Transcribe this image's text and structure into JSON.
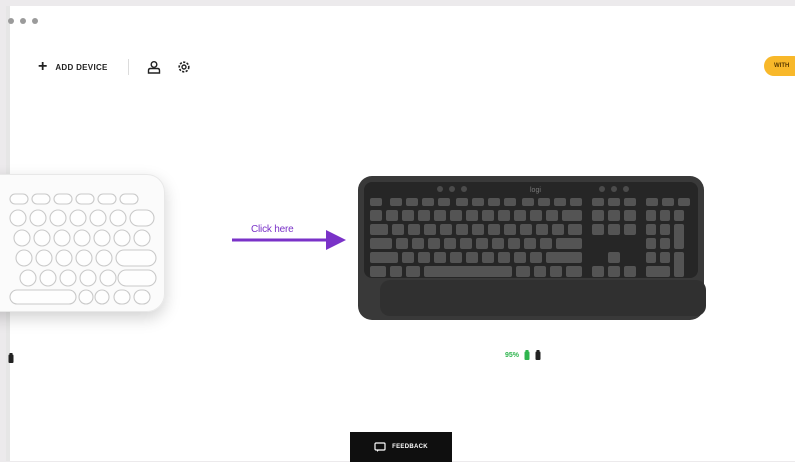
{
  "toolbar": {
    "add_device_label": "ADD DEVICE",
    "icons": [
      "plus-icon",
      "user-icon",
      "gear-icon"
    ]
  },
  "status_pill": {
    "label": "WITH",
    "color": "#f8b82a"
  },
  "devices": [
    {
      "name_icon": "white-keyboard-icon"
    },
    {
      "name_icon": "black-keyboard-icon",
      "battery": "95%",
      "battery_color": "#2fb54e"
    }
  ],
  "annotation": {
    "label": "Click here",
    "color": "#7a32c8"
  },
  "feedback": {
    "label": "FEEDBACK"
  }
}
